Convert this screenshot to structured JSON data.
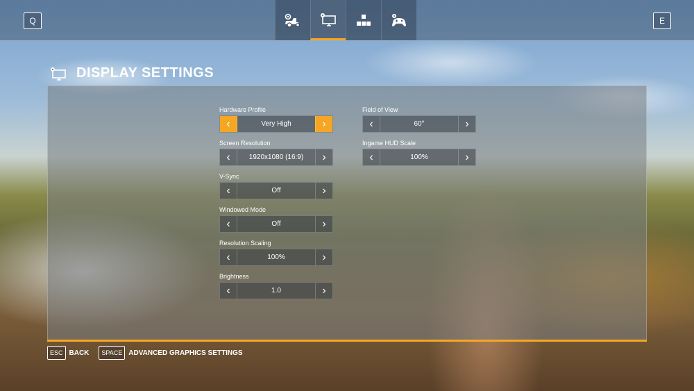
{
  "header": {
    "left_key": "Q",
    "right_key": "E",
    "tabs": [
      {
        "icon": "tractor-gear-icon",
        "active": false
      },
      {
        "icon": "monitor-gear-icon",
        "active": true
      },
      {
        "icon": "controls-icon",
        "active": false
      },
      {
        "icon": "gamepad-gear-icon",
        "active": false
      }
    ]
  },
  "page": {
    "title": "DISPLAY SETTINGS",
    "icon": "monitor-gear-icon"
  },
  "settings_left": [
    {
      "label": "Hardware Profile",
      "value": "Very High",
      "highlight": true
    },
    {
      "label": "Screen Resolution",
      "value": "1920x1080 (16:9)"
    },
    {
      "label": "V-Sync",
      "value": "Off"
    },
    {
      "label": "Windowed Mode",
      "value": "Off"
    },
    {
      "label": "Resolution Scaling",
      "value": "100%"
    },
    {
      "label": "Brightness",
      "value": "1.0"
    }
  ],
  "settings_right": [
    {
      "label": "Field of View",
      "value": "60°"
    },
    {
      "label": "Ingame HUD Scale",
      "value": "100%"
    }
  ],
  "footer": {
    "back_key": "ESC",
    "back_label": "BACK",
    "advanced_key": "SPACE",
    "advanced_label": "ADVANCED GRAPHICS SETTINGS"
  },
  "colors": {
    "accent": "#f5a623"
  }
}
